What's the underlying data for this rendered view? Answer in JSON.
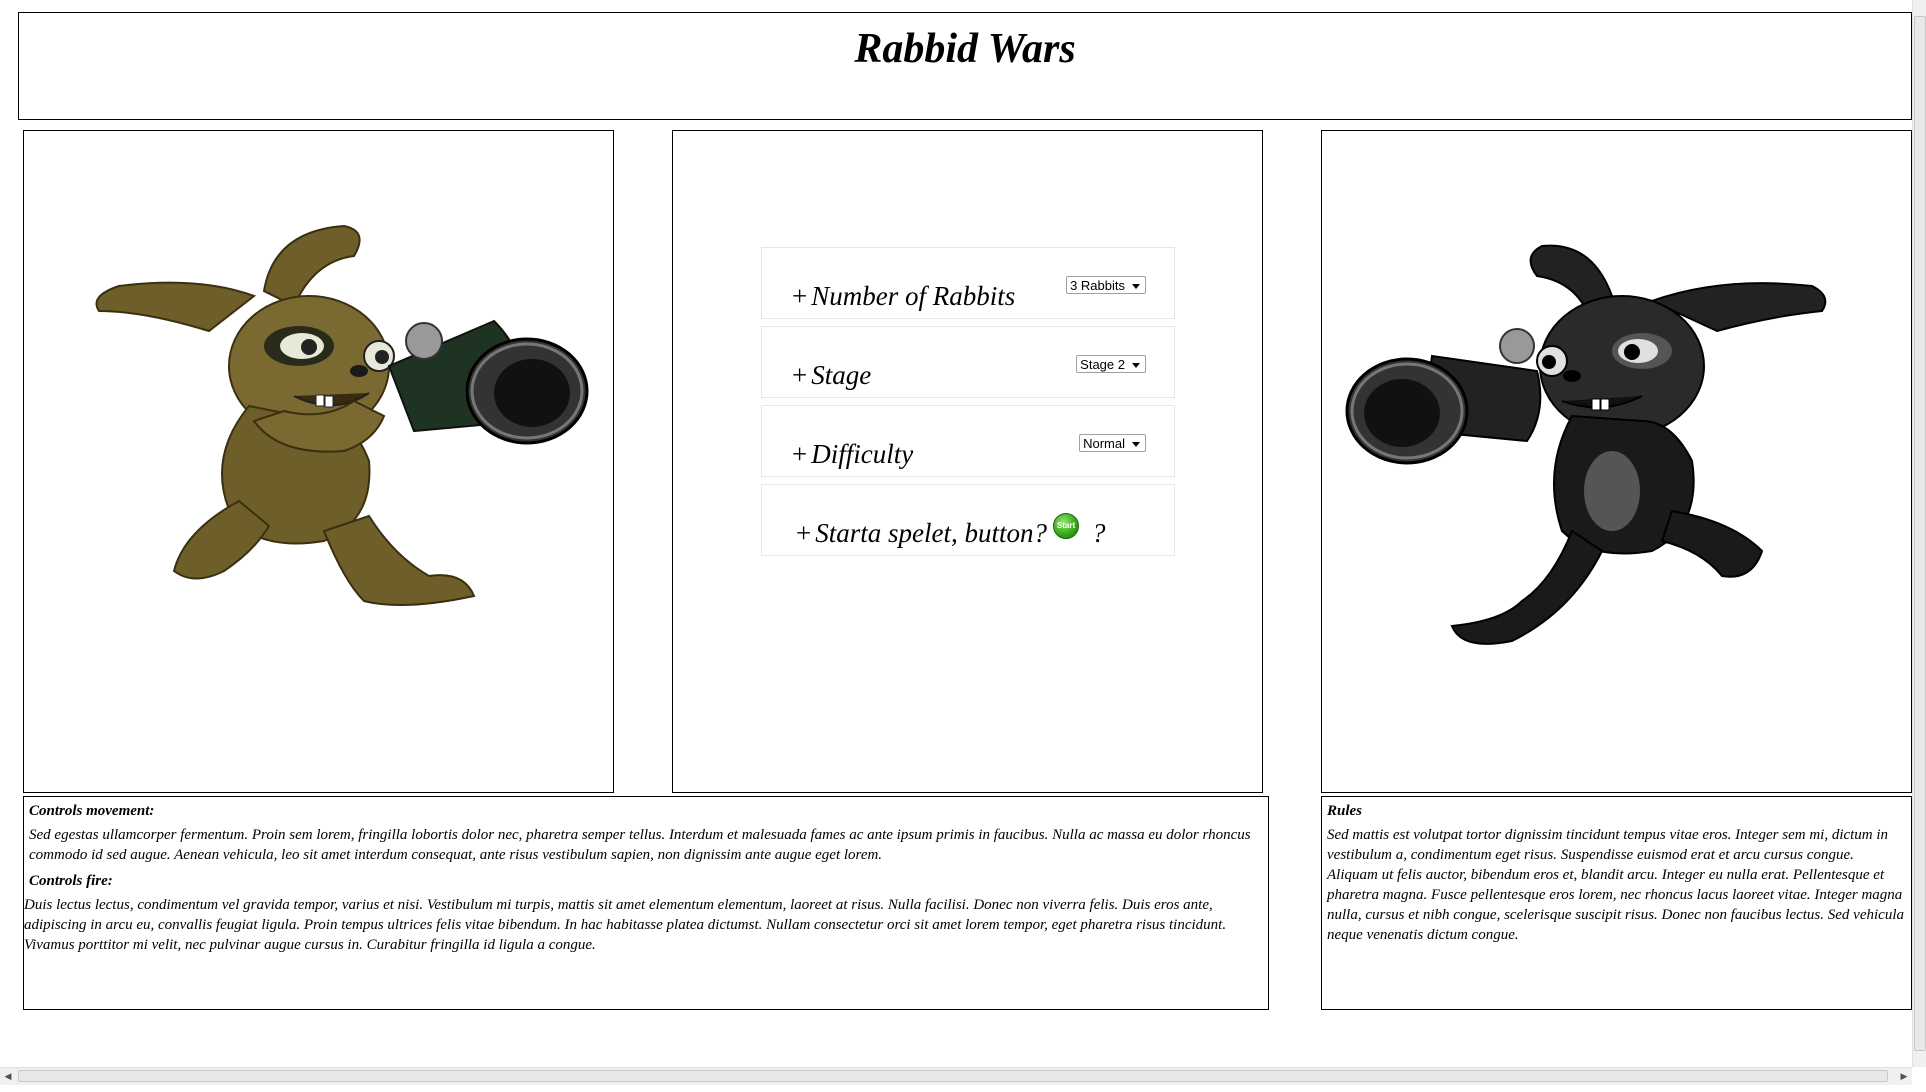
{
  "header": {
    "title": "Rabbid Wars"
  },
  "options": {
    "rabbits": {
      "label": "Number of Rabbits",
      "selected": "3 Rabbits"
    },
    "stage": {
      "label": "Stage",
      "selected": "Stage 2"
    },
    "difficulty": {
      "label": "Difficulty",
      "selected": "Normal"
    },
    "start": {
      "label": "Starta spelet, button?",
      "button_text": "Start",
      "question": "?"
    },
    "plus": "+"
  },
  "controls": {
    "movement_heading": "Controls movement:",
    "movement_text": "Sed egestas ullamcorper fermentum. Proin sem lorem, fringilla lobortis dolor nec, pharetra semper tellus. Interdum et malesuada fames ac ante ipsum primis in faucibus. Nulla ac massa eu dolor rhoncus commodo id sed augue. Aenean vehicula, leo sit amet interdum consequat, ante risus vestibulum sapien, non dignissim ante augue eget lorem.",
    "fire_heading": "Controls fire:",
    "fire_text": "Duis lectus lectus, condimentum vel gravida tempor, varius et nisi. Vestibulum mi turpis, mattis sit amet elementum elementum, laoreet at risus. Nulla facilisi. Donec non viverra felis. Duis eros ante, adipiscing in arcu eu, convallis feugiat ligula. Proin tempus ultrices felis vitae bibendum. In hac habitasse platea dictumst. Nullam consectetur orci sit amet lorem tempor, eget pharetra risus tincidunt. Vivamus porttitor mi velit, nec pulvinar augue cursus in. Curabitur fringilla id ligula a congue."
  },
  "rules": {
    "heading": "Rules",
    "text": "Sed mattis est volutpat tortor dignissim tincidunt tempus vitae eros. Integer sem mi, dictum in vestibulum a, condimentum eget risus. Suspendisse euismod erat et arcu cursus congue. Aliquam ut felis auctor, bibendum eros et, blandit arcu. Integer eu nulla erat. Pellentesque et pharetra magna. Fusce pellentesque eros lorem, nec rhoncus lacus laoreet vitae. Integer magna nulla, cursus et nibh congue, scelerisque suscipit risus. Donec non faucibus lectus. Sed vehicula neque venenatis dictum congue."
  },
  "images": {
    "left": "brown-rabbid-bazooka",
    "right": "black-rabbid-bazooka"
  },
  "colors": {
    "rabbid_brown": "#6e5f2a",
    "rabbid_black": "#1a1a1a",
    "start_green": "#34a318"
  }
}
